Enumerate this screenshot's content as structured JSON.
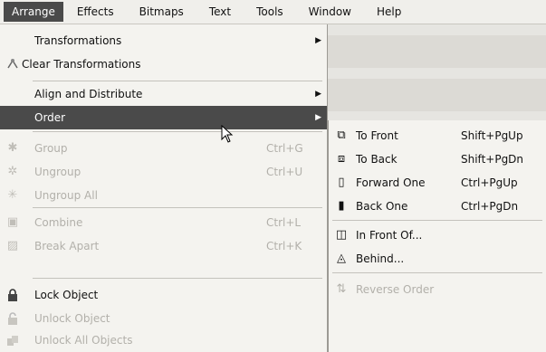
{
  "menubar": [
    "Arrange",
    "Effects",
    "Bitmaps",
    "Text",
    "Tools",
    "Window",
    "Help"
  ],
  "menu": {
    "transformations": "Transformations",
    "clear_transformations": "Clear Transformations",
    "align_distribute": "Align and Distribute",
    "order": "Order",
    "group": "Group",
    "group_sc": "Ctrl+G",
    "ungroup": "Ungroup",
    "ungroup_sc": "Ctrl+U",
    "ungroup_all": "Ungroup All",
    "combine": "Combine",
    "combine_sc": "Ctrl+L",
    "break_apart": "Break Apart",
    "break_apart_sc": "Ctrl+K",
    "lock": "Lock Object",
    "unlock": "Unlock Object",
    "unlock_all": "Unlock All Objects"
  },
  "submenu": {
    "to_front": "To Front",
    "to_front_sc": "Shift+PgUp",
    "to_back": "To Back",
    "to_back_sc": "Shift+PgDn",
    "forward_one": "Forward One",
    "forward_one_sc": "Ctrl+PgUp",
    "back_one": "Back One",
    "back_one_sc": "Ctrl+PgDn",
    "in_front_of": "In Front Of...",
    "behind": "Behind...",
    "reverse_order": "Reverse Order"
  },
  "colors": {
    "highlight": "#4a4a4a",
    "menu_bg": "#f4f3ef",
    "disabled": "#b2b0aa"
  }
}
